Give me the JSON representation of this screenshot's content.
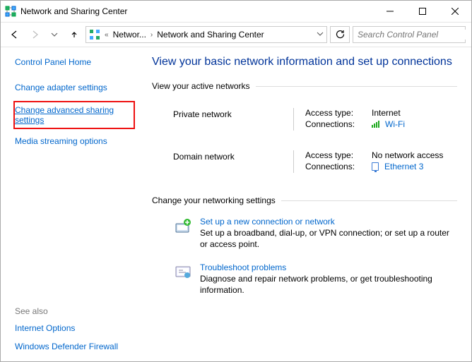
{
  "window": {
    "title": "Network and Sharing Center"
  },
  "address": {
    "crumb1": "Networ...",
    "crumb2": "Network and Sharing Center"
  },
  "search": {
    "placeholder": "Search Control Panel"
  },
  "sidebar": {
    "home": "Control Panel Home",
    "adapter": "Change adapter settings",
    "advanced": "Change advanced sharing settings",
    "media": "Media streaming options",
    "see_also": "See also",
    "internet": "Internet Options",
    "firewall": "Windows Defender Firewall"
  },
  "content": {
    "title": "View your basic network information and set up connections",
    "active_label": "View your active networks",
    "net1": {
      "name": "Private network",
      "k1": "Access type:",
      "v1": "Internet",
      "k2": "Connections:",
      "v2": "Wi-Fi"
    },
    "net2": {
      "name": "Domain network",
      "k1": "Access type:",
      "v1": "No network access",
      "k2": "Connections:",
      "v2": "Ethernet 3"
    },
    "change_label": "Change your networking settings",
    "task1": {
      "title": "Set up a new connection or network",
      "desc": "Set up a broadband, dial-up, or VPN connection; or set up a router or access point."
    },
    "task2": {
      "title": "Troubleshoot problems",
      "desc": "Diagnose and repair network problems, or get troubleshooting information."
    }
  }
}
